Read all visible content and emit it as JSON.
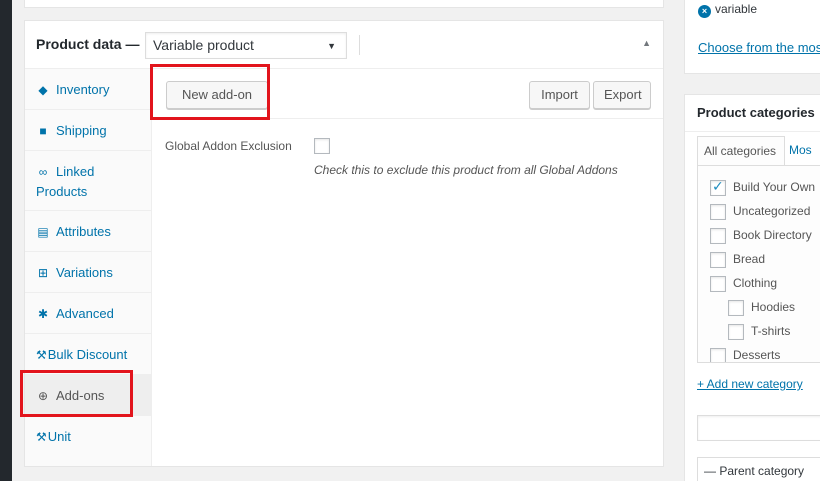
{
  "product_data": {
    "title": "Product data —",
    "type_select_value": "Variable product",
    "tabs": [
      {
        "label": "Inventory",
        "icon": "tag-icon"
      },
      {
        "label": "Shipping",
        "icon": "truck-icon"
      },
      {
        "label": "Linked Products",
        "icon": "link-icon"
      },
      {
        "label": "Attributes",
        "icon": "list-icon"
      },
      {
        "label": "Variations",
        "icon": "grid-icon"
      },
      {
        "label": "Advanced",
        "icon": "gear-icon"
      },
      {
        "label": "Bulk Discount",
        "icon": "wrench-icon"
      },
      {
        "label": "Add-ons",
        "icon": "plus-circle-icon",
        "active": true
      },
      {
        "label": "Unit",
        "icon": "wrench-icon"
      }
    ],
    "panel": {
      "new_addon_label": "New add-on",
      "import_label": "Import",
      "export_label": "Export",
      "exclusion_label": "Global Addon Exclusion",
      "exclusion_description": "Check this to exclude this product from all Global Addons"
    }
  },
  "tags": {
    "item": "variable",
    "choose_link": "Choose from the mos"
  },
  "categories": {
    "title": "Product categories",
    "tab_all": "All categories",
    "tab_most": "Mos",
    "items": [
      {
        "label": "Build Your Own",
        "checked": true,
        "indent": 0
      },
      {
        "label": "Uncategorized",
        "checked": false,
        "indent": 0
      },
      {
        "label": "Book Directory",
        "checked": false,
        "indent": 0
      },
      {
        "label": "Bread",
        "checked": false,
        "indent": 0
      },
      {
        "label": "Clothing",
        "checked": false,
        "indent": 0
      },
      {
        "label": "Hoodies",
        "checked": false,
        "indent": 1
      },
      {
        "label": "T-shirts",
        "checked": false,
        "indent": 1
      },
      {
        "label": "Desserts",
        "checked": false,
        "indent": 0
      }
    ],
    "add_new_link": "+ Add new category",
    "parent_select_value": "— Parent category"
  },
  "colors": {
    "link": "#0073aa",
    "highlight": "#e2141c"
  }
}
